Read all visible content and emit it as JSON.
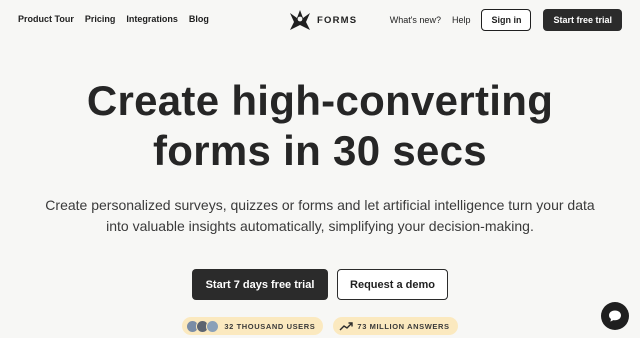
{
  "nav": {
    "left_links": [
      "Product Tour",
      "Pricing",
      "Integrations",
      "Blog"
    ],
    "logo_text": "FORMS",
    "whats_new": "What's new?",
    "help": "Help",
    "signin": "Sign in",
    "start_trial": "Start free trial"
  },
  "hero": {
    "title_line1": "Create high-converting",
    "title_line2": "forms in 30 secs",
    "subtitle_line1": "Create personalized surveys, quizzes or forms and let artificial intelligence turn your data",
    "subtitle_line2": "into valuable insights automatically, simplifying your decision-making.",
    "primary_cta": "Start 7 days free trial",
    "secondary_cta": "Request a demo"
  },
  "badges": {
    "users": "32 THOUSAND USERS",
    "answers": "73 MILLION ANSWERS"
  },
  "colors": {
    "background": "#f7f7f5",
    "dark": "#2b2b2b",
    "badge": "#fbe9bf"
  },
  "icons": [
    "logo-mark-icon",
    "trend-up-icon",
    "chat-bubble-icon"
  ]
}
